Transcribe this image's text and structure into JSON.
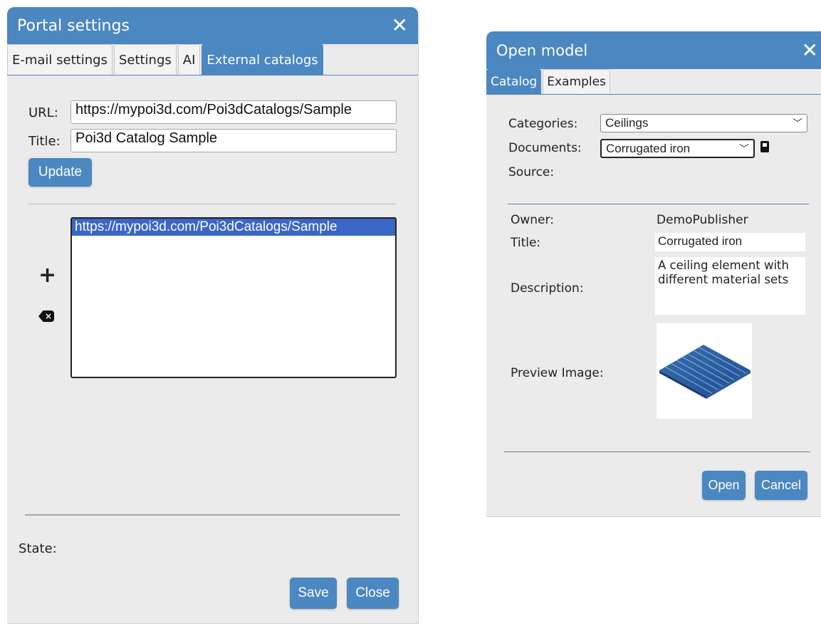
{
  "portal": {
    "title": "Portal settings",
    "close_glyph": "✕",
    "tabs": [
      {
        "label": "E-mail settings"
      },
      {
        "label": "Settings"
      },
      {
        "label": "AI"
      },
      {
        "label": "External catalogs",
        "active": true
      }
    ],
    "url_label": "URL:",
    "url_value": "https://mypoi3d.com/Poi3dCatalogs/Sample",
    "title_label": "Title:",
    "title_value": "Poi3d Catalog Sample",
    "update_label": "Update",
    "add_glyph": "+",
    "delete_glyph": "⌫",
    "list_items": [
      "https://mypoi3d.com/Poi3dCatalogs/Sample"
    ],
    "state_label": "State:",
    "save_label": "Save",
    "close_label": "Close"
  },
  "open_model": {
    "title": "Open model",
    "close_glyph": "✕",
    "tabs": [
      {
        "label": "Catalog",
        "active": true
      },
      {
        "label": "Examples"
      }
    ],
    "categories_label": "Categories:",
    "categories_value": "Ceilings",
    "documents_label": "Documents:",
    "documents_value": "Corrugated iron",
    "source_label": "Source:",
    "owner_label": "Owner:",
    "owner_value": "DemoPublisher",
    "title_label": "Title:",
    "title_value": "Corrugated iron",
    "description_label": "Description:",
    "description_value": "A ceiling element with different material sets",
    "preview_label": "Preview Image:",
    "open_label": "Open",
    "cancel_label": "Cancel"
  },
  "colors": {
    "accent": "#4b87c1",
    "dialog_bg": "#ebebeb",
    "selection": "#3a66c6"
  },
  "icons": [
    "close-icon",
    "plus-icon",
    "backspace-icon",
    "book-icon",
    "chevron-down-icon"
  ]
}
